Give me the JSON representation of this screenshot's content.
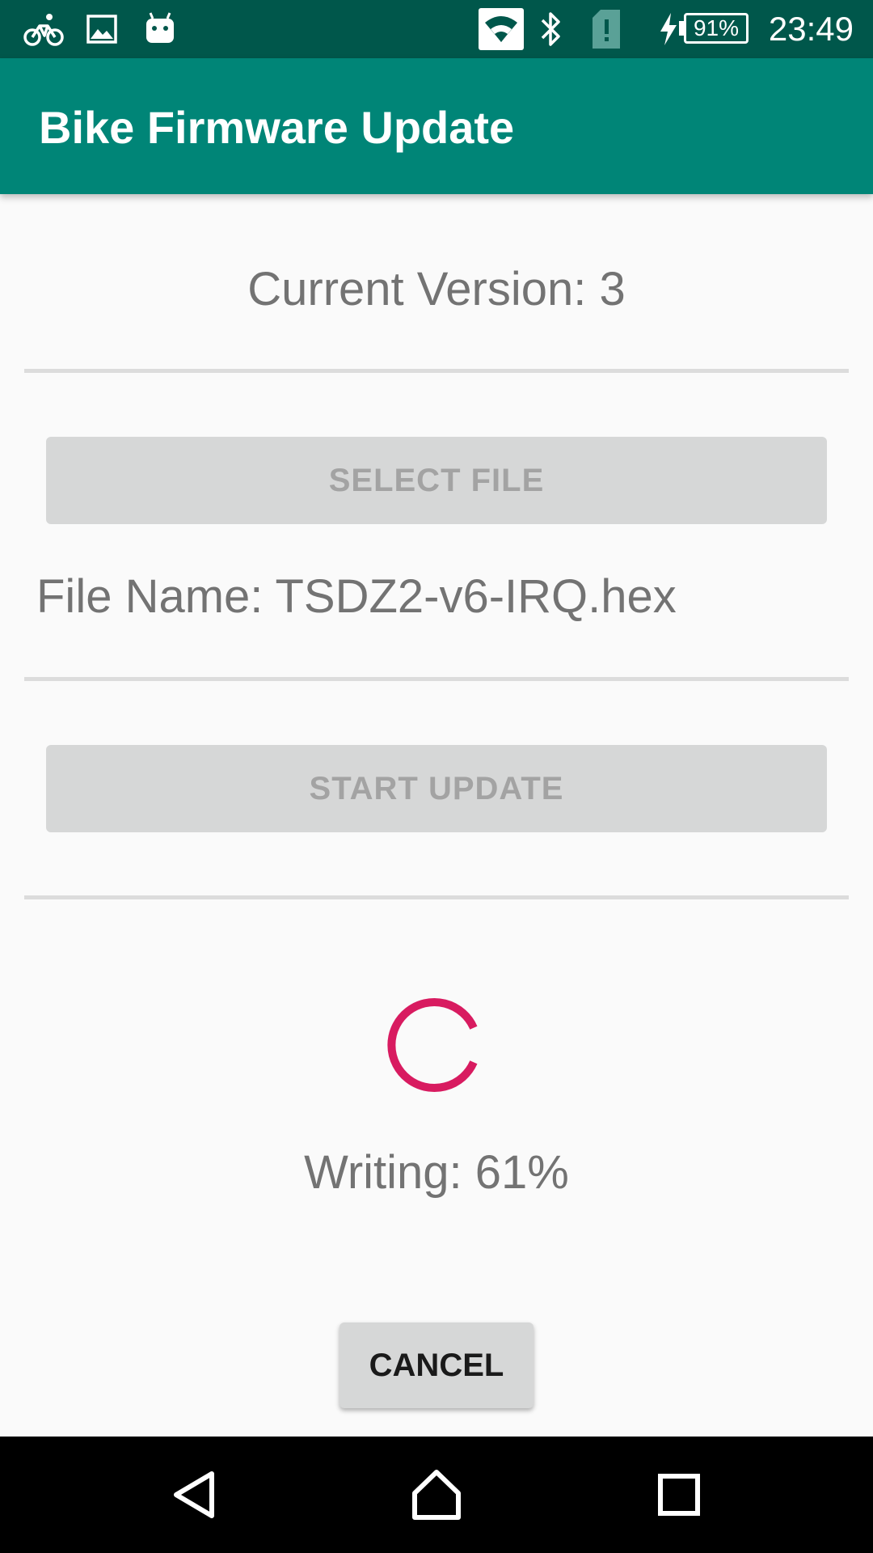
{
  "status_bar": {
    "time": "23:49",
    "battery_level": "91%",
    "icons": [
      "bike-icon",
      "image-icon",
      "android-icon",
      "wifi-icon",
      "bluetooth-icon",
      "sim-alert-icon",
      "charging-icon",
      "battery-icon"
    ]
  },
  "app_bar": {
    "title": "Bike Firmware Update"
  },
  "main": {
    "current_version": "Current Version: 3",
    "select_file_label": "SELECT FILE",
    "file_name": "File Name: TSDZ2-v6-IRQ.hex",
    "start_update_label": "START UPDATE",
    "writing_status": "Writing: 61%",
    "progress_percent": 61,
    "cancel_label": "CANCEL"
  },
  "nav_bar": {
    "buttons": [
      "back-icon",
      "home-icon",
      "recents-icon"
    ]
  },
  "colors": {
    "status_bar": "#00574b",
    "app_bar": "#008577",
    "accent": "#d81b60",
    "background": "#fafafa"
  }
}
